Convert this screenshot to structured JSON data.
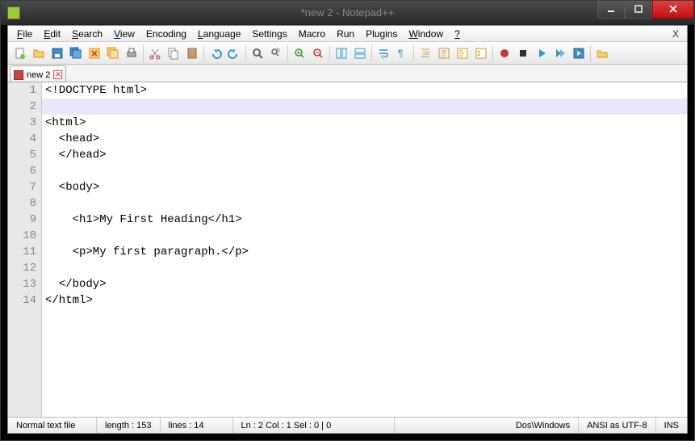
{
  "title": "*new  2 - Notepad++",
  "menus": [
    "File",
    "Edit",
    "Search",
    "View",
    "Encoding",
    "Language",
    "Settings",
    "Macro",
    "Run",
    "Plugins",
    "Window",
    "?"
  ],
  "tab": {
    "name": "new  2"
  },
  "lines": [
    "<!DOCTYPE html>",
    "",
    "<html>",
    "  <head>",
    "  </head>",
    "",
    "  <body>",
    "",
    "    <h1>My First Heading</h1>",
    "",
    "    <p>My first paragraph.</p>",
    "",
    "  </body>",
    "</html>"
  ],
  "currentLine": 2,
  "status": {
    "type": "Normal text file",
    "length": "length : 153",
    "lines": "lines : 14",
    "pos": "Ln : 2    Col : 1    Sel : 0 | 0",
    "eol": "Dos\\Windows",
    "enc": "ANSI as UTF-8",
    "mode": "INS"
  }
}
